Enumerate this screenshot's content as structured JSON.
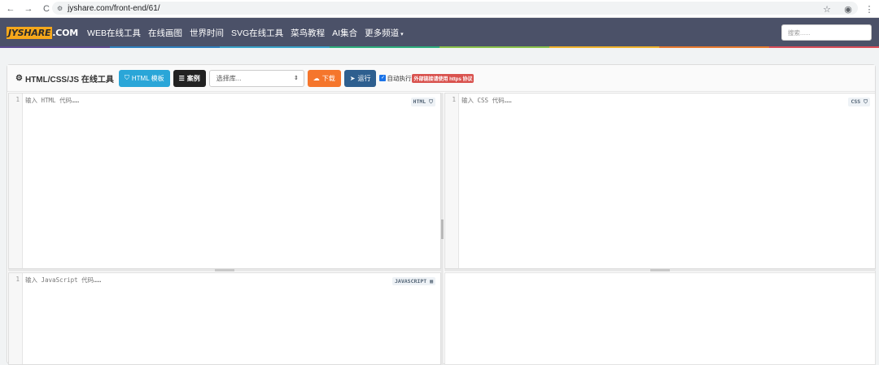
{
  "browser": {
    "back_icon": "←",
    "forward_icon": "→",
    "reload_icon": "C",
    "site_info_icon": "⚙",
    "url": "jyshare.com/front-end/61/",
    "star_icon": "☆",
    "account_icon": "◉",
    "menu_icon": "⋮"
  },
  "navbar": {
    "logo_main": "JYSHARE",
    "logo_suffix": ".COM",
    "links": [
      "WEB在线工具",
      "在线画图",
      "世界时间",
      "SVG在线工具",
      "菜鸟教程",
      "AI集合",
      "更多频道"
    ],
    "more_caret": "▾",
    "search_placeholder": "搜索......",
    "stripe_colors": [
      "#5b4a8f",
      "#2f7fbd",
      "#3aa3c9",
      "#2eae7d",
      "#8ac14a",
      "#f0b32c",
      "#e8792f",
      "#d94d59"
    ]
  },
  "toolbar": {
    "title_icon": "⚙",
    "title": "HTML/CSS/JS 在线工具",
    "html_template_icon": "⛉",
    "html_template_label": "HTML 模板",
    "examples_icon": "☰",
    "examples_label": "案例",
    "library_select_value": "选择库...",
    "library_select_arrow": "⇕",
    "download_icon": "☁",
    "download_label": "下载",
    "run_icon": "➤",
    "run_label": "运行",
    "autorun_check": "✓",
    "autorun_label": "自动执行",
    "https_notice": "外部链接请使用 https 协议"
  },
  "editors": {
    "html": {
      "line": "1",
      "placeholder": "输入 HTML 代码……",
      "tag": "HTML",
      "tag_icon": "⛉"
    },
    "css": {
      "line": "1",
      "placeholder": "输入 CSS 代码……",
      "tag": "CSS",
      "tag_icon": "⛉"
    },
    "js": {
      "line": "1",
      "placeholder": "输入 JavaScript 代码……",
      "tag": "JAVASCRIPT",
      "tag_icon": "▦"
    }
  },
  "colors": {
    "navbar_bg": "#4b5168",
    "logo_box": "#f6a81b",
    "btn_info": "#2aa6d8",
    "btn_dark": "#222222",
    "btn_download": "#f5762c",
    "btn_run": "#2e5f8f",
    "notice_red": "#d9534f"
  }
}
